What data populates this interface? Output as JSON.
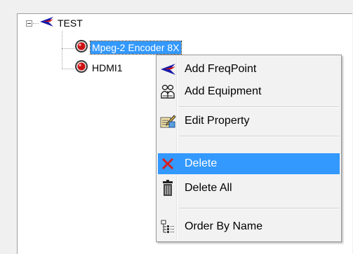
{
  "tree": {
    "root": {
      "label": "TEST",
      "icon": "freqpoint-arrow-icon",
      "expanded": true
    },
    "children": [
      {
        "label": "Mpeg-2 Encoder 8X",
        "icon": "red-record-icon",
        "selected": true
      },
      {
        "label": "HDMI1",
        "icon": "red-record-icon",
        "selected": false
      }
    ]
  },
  "context_menu": {
    "items": [
      {
        "label": "Add FreqPoint",
        "icon": "freqpoint-arrow-icon"
      },
      {
        "label": "Add Equipment",
        "icon": "equipment-icon"
      },
      {
        "label": "Edit Property",
        "icon": "edit-property-icon"
      },
      {
        "label": "Delete",
        "icon": "delete-x-icon",
        "highlighted": true
      },
      {
        "label": "Delete All",
        "icon": "trash-icon"
      },
      {
        "label": "Order By Name",
        "icon": "order-list-icon"
      }
    ]
  },
  "colors": {
    "selection": "#3399ff",
    "menu_background": "#f2f2f2",
    "arrow_blue": "#1a1aa6",
    "arrow_red": "#d01010",
    "record_red": "#cc1111",
    "delete_red": "#d42020"
  }
}
